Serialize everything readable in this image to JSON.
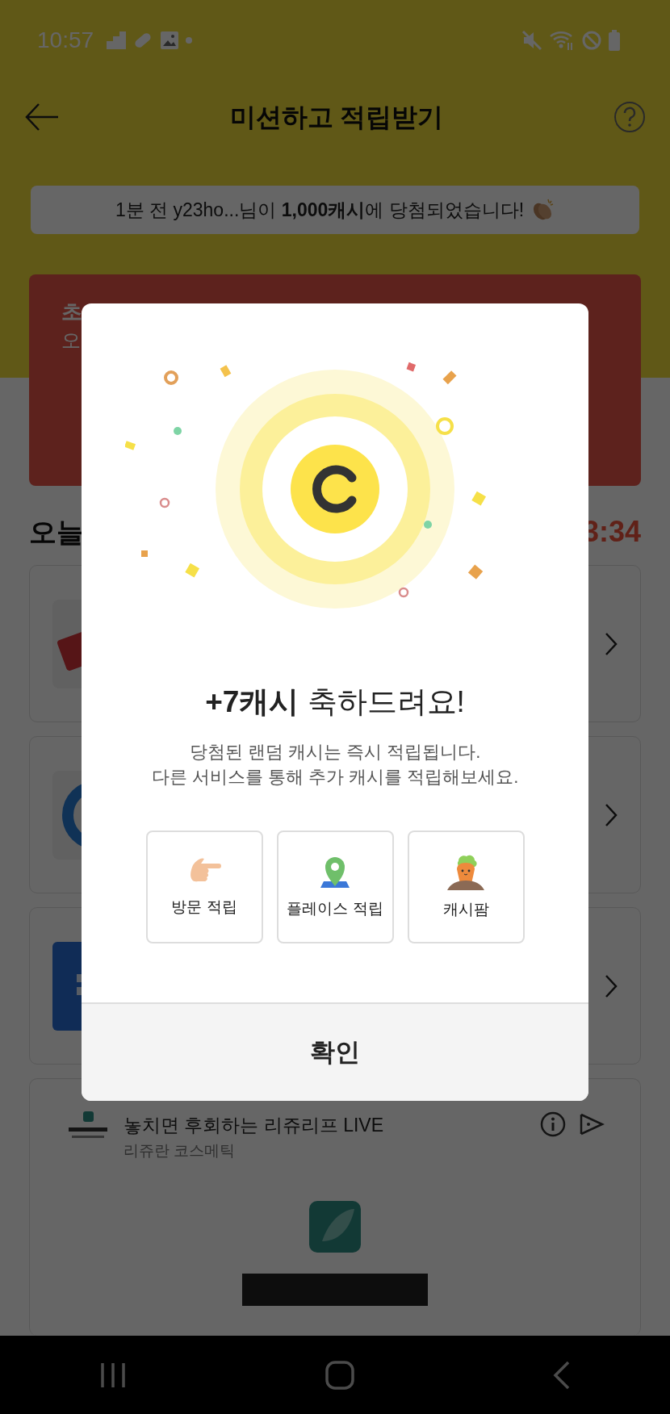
{
  "status_bar": {
    "time": "10:57"
  },
  "header": {
    "title": "미션하고 적립받기"
  },
  "ticker": {
    "text": "1분 전 y23ho...님이 **1,000캐시**에 당첨되었습니다!"
  },
  "banner": {
    "title": "초",
    "subtitle": "오"
  },
  "section": {
    "title": "오늘",
    "timer": "3:34"
  },
  "missions": [
    {
      "kind": "tag"
    },
    {
      "kind": "ring"
    },
    {
      "kind": "tile"
    }
  ],
  "ad": {
    "title": "놓치면 후회하는 리쥬리프 LIVE",
    "advertiser": "리쥬란 코스메틱"
  },
  "dialog": {
    "title": "**+7캐시** 축하드려요!",
    "message_lines": [
      "당첨된 랜덤 캐시는 즉시 적립됩니다.",
      "다른 서비스를 통해 추가 캐시를 적립해보세요."
    ],
    "shortcuts": [
      {
        "kind": "visit",
        "label": "방문 적립"
      },
      {
        "kind": "place",
        "label": "플레이스 적립"
      },
      {
        "kind": "farm",
        "label": "캐시팜"
      }
    ],
    "confirm": "확인"
  }
}
